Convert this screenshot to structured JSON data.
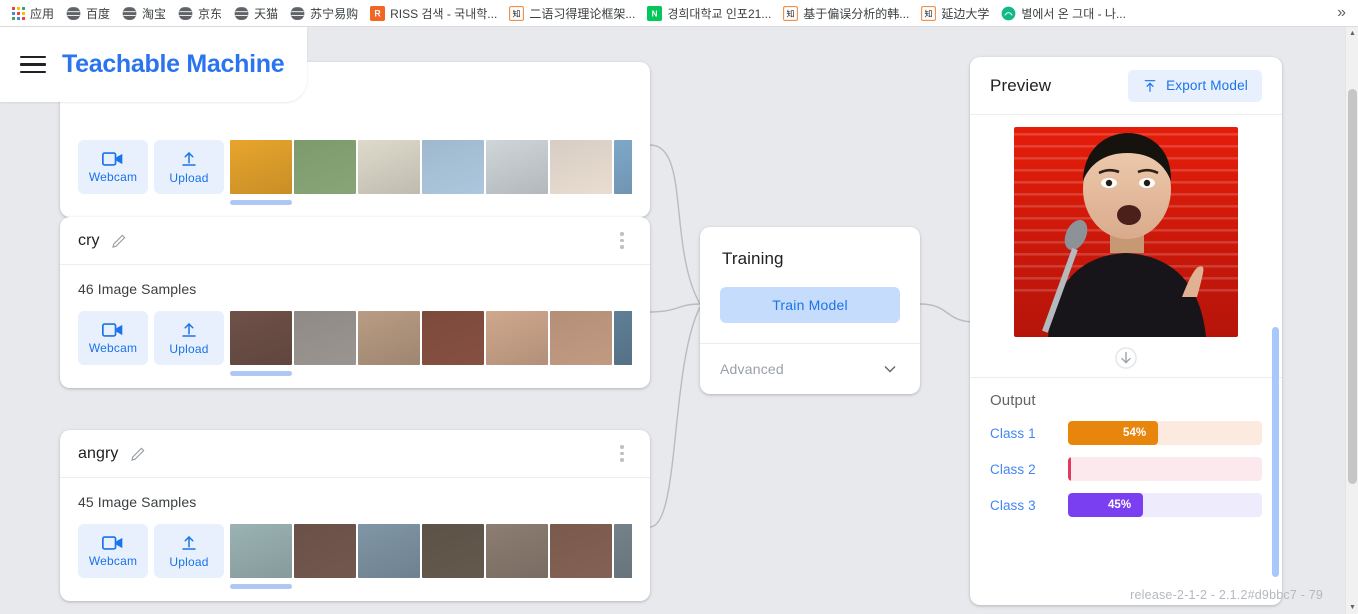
{
  "browser": {
    "bookmarks": [
      {
        "label": "应用",
        "icon": "apps-grid-icon",
        "type": "apps"
      },
      {
        "label": "百度",
        "icon": "globe-icon",
        "type": "globe"
      },
      {
        "label": "淘宝",
        "icon": "globe-icon",
        "type": "globe"
      },
      {
        "label": "京东",
        "icon": "globe-icon",
        "type": "globe"
      },
      {
        "label": "天猫",
        "icon": "globe-icon",
        "type": "globe"
      },
      {
        "label": "苏宁易购",
        "icon": "globe-icon",
        "type": "globe"
      },
      {
        "label": "RISS 검색 - 국내학...",
        "icon": "riss-icon",
        "type": "riss"
      },
      {
        "label": "二语习得理论框架...",
        "icon": "zhihu-icon",
        "type": "zhi"
      },
      {
        "label": "경희대학교 인포21...",
        "icon": "naver-icon",
        "type": "naver"
      },
      {
        "label": "基于偏误分析的韩...",
        "icon": "zhihu-icon",
        "type": "zhi"
      },
      {
        "label": "延边大学",
        "icon": "zhihu-icon",
        "type": "zhi"
      },
      {
        "label": "별에서 온 그대 - 나...",
        "icon": "green-circle-icon",
        "type": "green"
      }
    ],
    "overflow_label": "»",
    "scrollbar": {
      "up_arrow": "▲",
      "down_arrow": "▼"
    }
  },
  "app_header": {
    "menu_icon": "hamburger-icon",
    "title": "Teachable Machine"
  },
  "classes": [
    {
      "name": "",
      "samples_label": "",
      "webcam_label": "Webcam",
      "upload_label": "Upload",
      "thumbs": [
        "#e8a52c",
        "#7d9a6d",
        "#dedacb",
        "#9fb8cd",
        "#cfd6da",
        "#d8cdc2",
        "#7ea8c8"
      ]
    },
    {
      "name": "cry",
      "samples_label": "46 Image Samples",
      "webcam_label": "Webcam",
      "upload_label": "Upload",
      "thumbs": [
        "#6f5148",
        "#8f8a86",
        "#b99c83",
        "#7c4a3c",
        "#cfa88d",
        "#b48f78",
        "#5f7f96"
      ]
    },
    {
      "name": "angry",
      "samples_label": "45 Image Samples",
      "webcam_label": "Webcam",
      "upload_label": "Upload",
      "thumbs": [
        "#9bb3b4",
        "#6a5148",
        "#8096a6",
        "#5d5247",
        "#8d7d72",
        "#7a5a4e",
        "#74828a"
      ]
    }
  ],
  "training": {
    "title": "Training",
    "train_button": "Train Model",
    "advanced_label": "Advanced",
    "chevron_icon": "chevron-down-icon"
  },
  "preview": {
    "title": "Preview",
    "export_button": "Export Model",
    "export_icon": "export-upload-icon",
    "arrow_icon": "arrow-down-icon",
    "output_title": "Output",
    "classes": [
      {
        "label": "Class 1",
        "percent": 54,
        "percent_label": "54%",
        "color": "#e8850c",
        "track": "#fdeade"
      },
      {
        "label": "Class 2",
        "percent": 1,
        "percent_label": "",
        "color": "#e23a5e",
        "track": "#fce9ed"
      },
      {
        "label": "Class 3",
        "percent": 45,
        "percent_label": "45%",
        "color": "#7b3ff2",
        "track": "#eeebfd"
      }
    ]
  },
  "footer": {
    "release": "release-2-1-2 - 2.1.2#d9bbc7 - 79"
  },
  "colors": {
    "background": "#e8e9ed",
    "accent": "#1a73e8",
    "brand_blue": "#2a74f0",
    "card": "#ffffff"
  }
}
